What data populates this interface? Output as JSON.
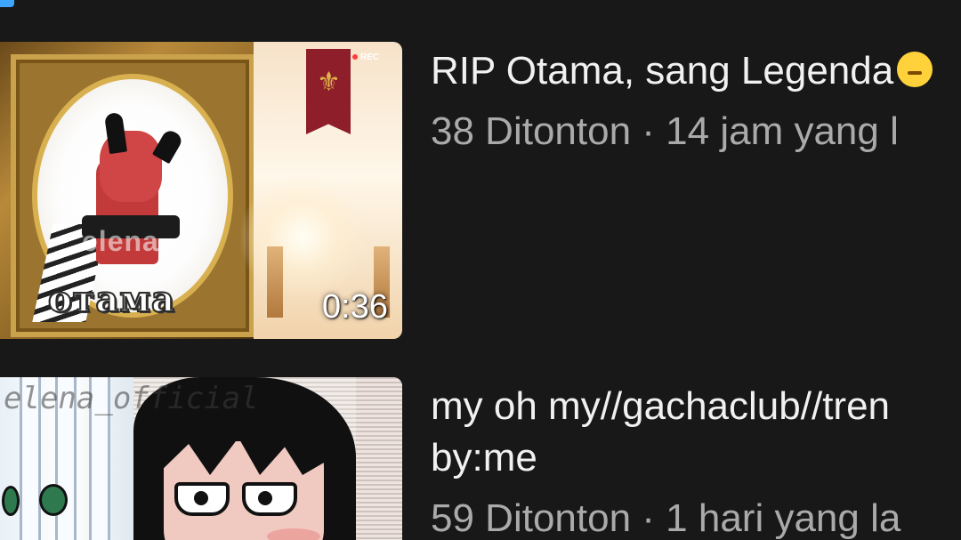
{
  "videos": [
    {
      "title": "RIP Otama, sang Legenda",
      "stats": "38 Ditonton · 14 jam yang l",
      "duration": "0:36",
      "thumbnail_text": "отама",
      "thumbnail_watermark": "elena",
      "thumbnail_badge": "REC"
    },
    {
      "title_line1": "my oh my//gachaclub//tren",
      "title_line2": "by:me",
      "stats": "59 Ditonton · 1 hari yang la",
      "thumbnail_watermark": "elena_official"
    }
  ],
  "colors": {
    "background": "#181818",
    "title": "#f1f1f1",
    "meta": "#aaaaaa",
    "accent": "#3ea6ff"
  },
  "icons": {
    "title_emoji": "face-emoji-icon"
  }
}
